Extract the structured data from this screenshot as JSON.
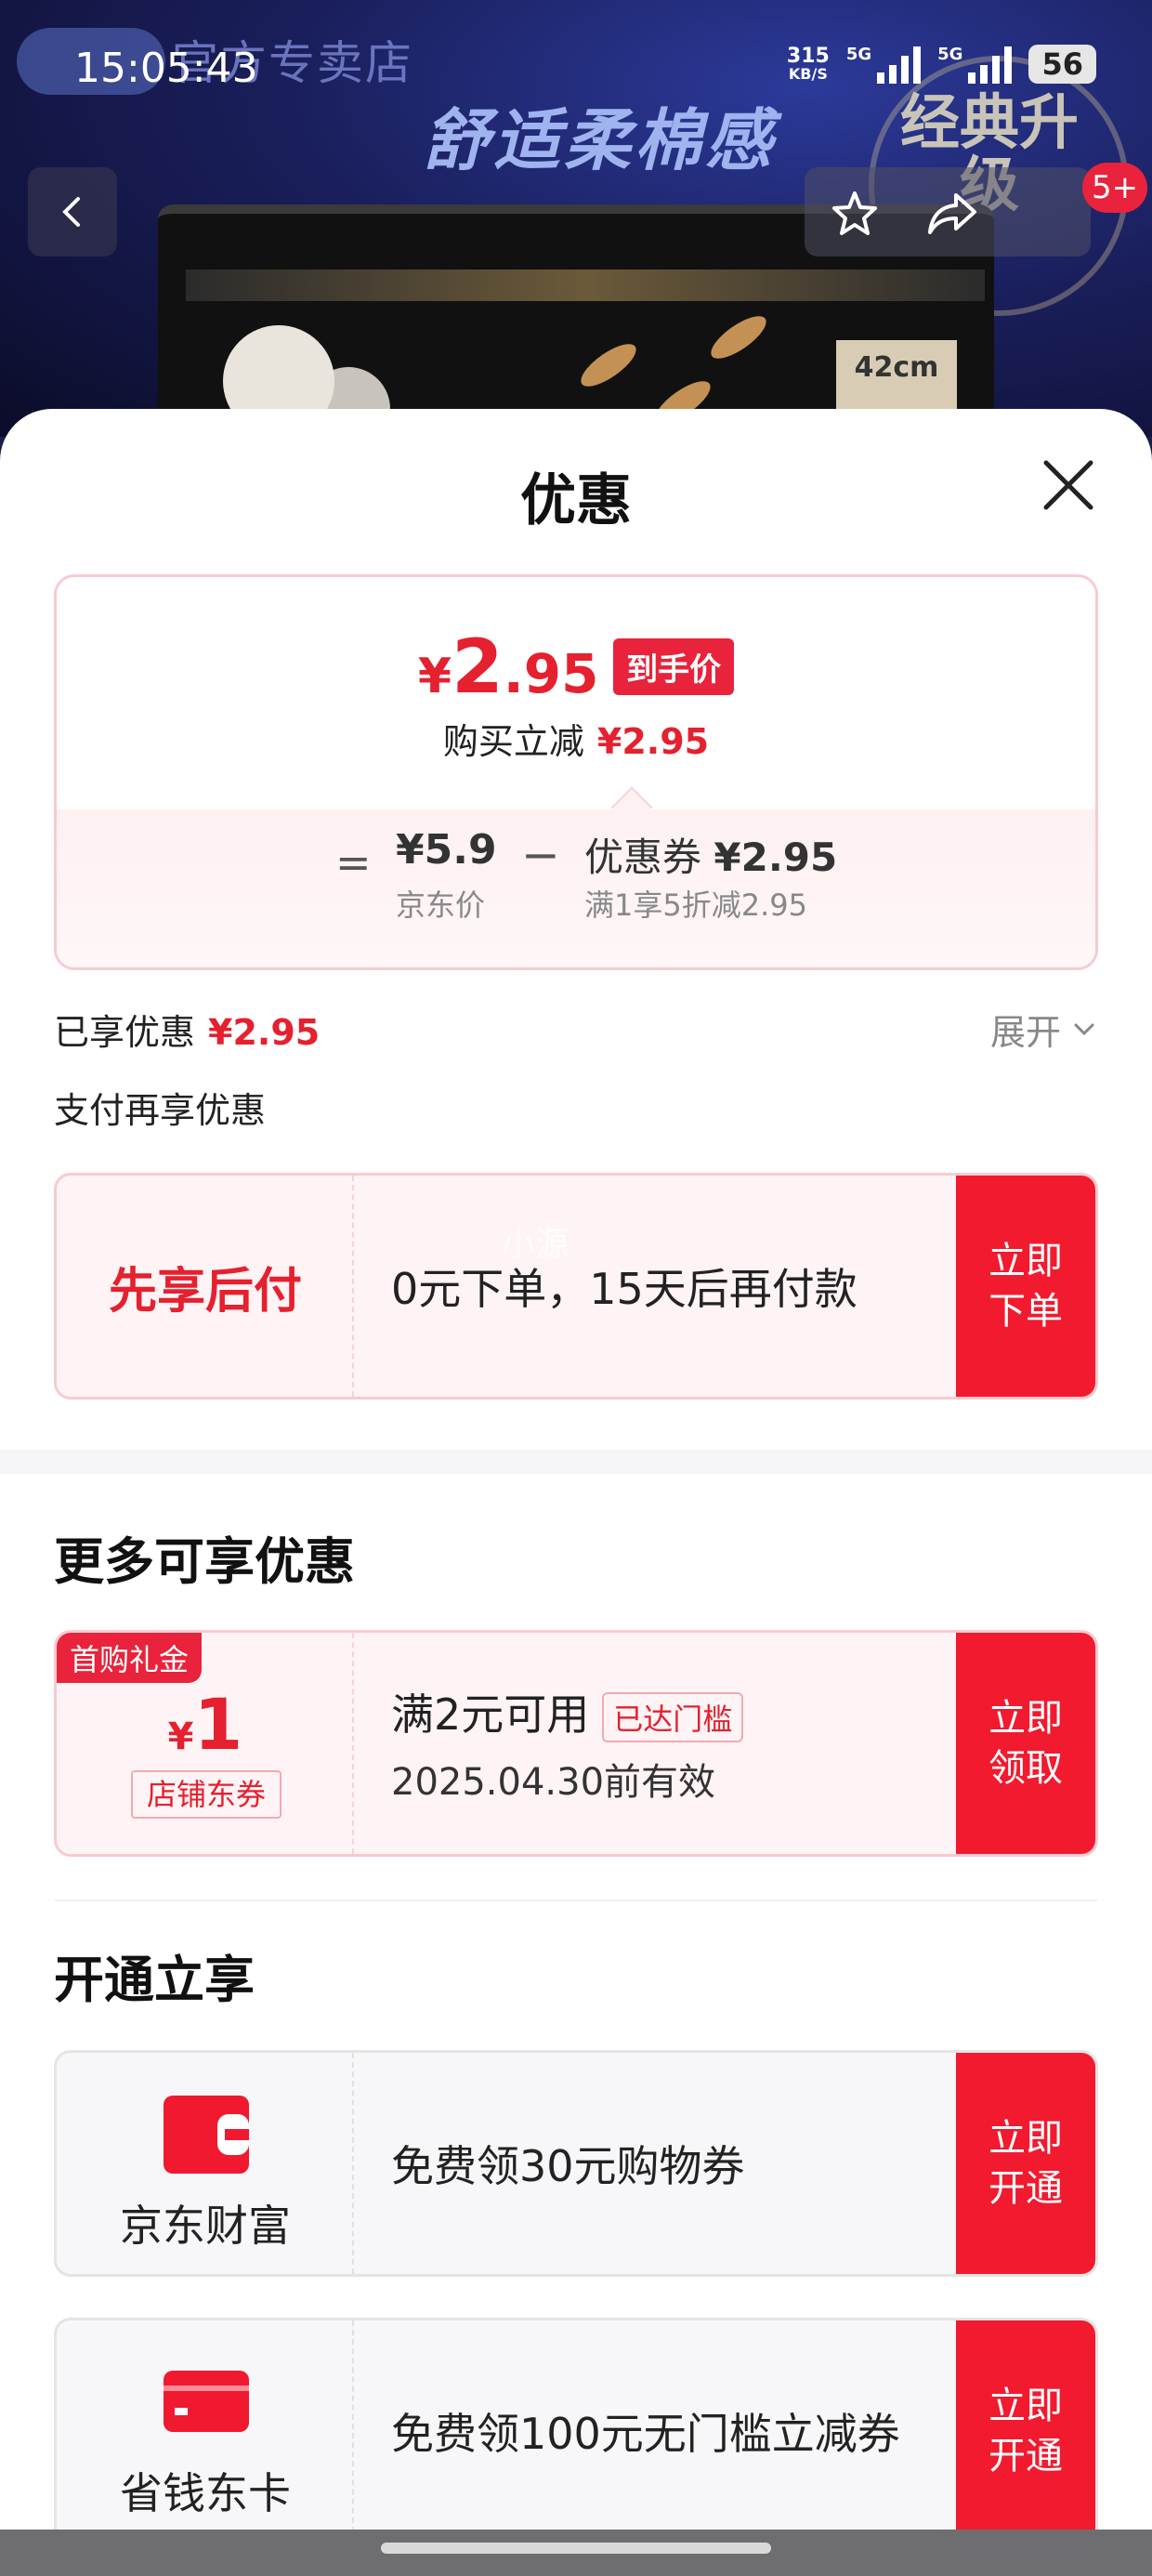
{
  "status_bar": {
    "time": "15:05:43",
    "net_speed_value": "315",
    "net_speed_unit": "KB/S",
    "network_1": "5G",
    "network_2": "5G",
    "battery": "56"
  },
  "banner": {
    "shop_name": "官方专卖店",
    "slogan": "舒适柔棉感",
    "upgrade_text": "经典升级",
    "size_label": "42cm",
    "nav_badge": "5+"
  },
  "sheet": {
    "title": "优惠",
    "final_price": {
      "currency": "¥",
      "integer": "2",
      "decimal": ".95"
    },
    "final_price_tag": "到手价",
    "instant_cut_label": "购买立减",
    "instant_cut_value": "¥2.95",
    "equals": "=",
    "jd_price": "¥5.9",
    "jd_price_label": "京东价",
    "minus": "−",
    "coupon_label": "优惠券",
    "coupon_value": "¥2.95",
    "coupon_rule": "满1享5折减2.95",
    "enjoyed_label": "已享优惠",
    "enjoyed_value": "¥2.95",
    "expand_label": "展开",
    "pay_more_label": "支付再享优惠"
  },
  "bnpl": {
    "title": "先享后付",
    "desc": "0元下单，15天后再付款",
    "button": "立即\n下单",
    "watermark": "小源"
  },
  "more_offers": {
    "title": "更多可享优惠",
    "coupon": {
      "ribbon": "首购礼金",
      "currency": "¥",
      "amount": "1",
      "type": "店铺东券",
      "condition": "满2元可用",
      "status": "已达门槛",
      "validity": "2025.04.30前有效",
      "button": "立即\n领取"
    }
  },
  "open_enjoy": {
    "title": "开通立享",
    "items": [
      {
        "name": "京东财富",
        "desc": "免费领30元购物券",
        "button": "立即\n开通"
      },
      {
        "name": "省钱东卡",
        "desc": "免费领100元无门槛立减券",
        "button": "立即\n开通"
      }
    ]
  },
  "colors": {
    "accent_red": "#e5202f",
    "button_red": "#f11a2f",
    "card_pink": "#fff4f5"
  }
}
